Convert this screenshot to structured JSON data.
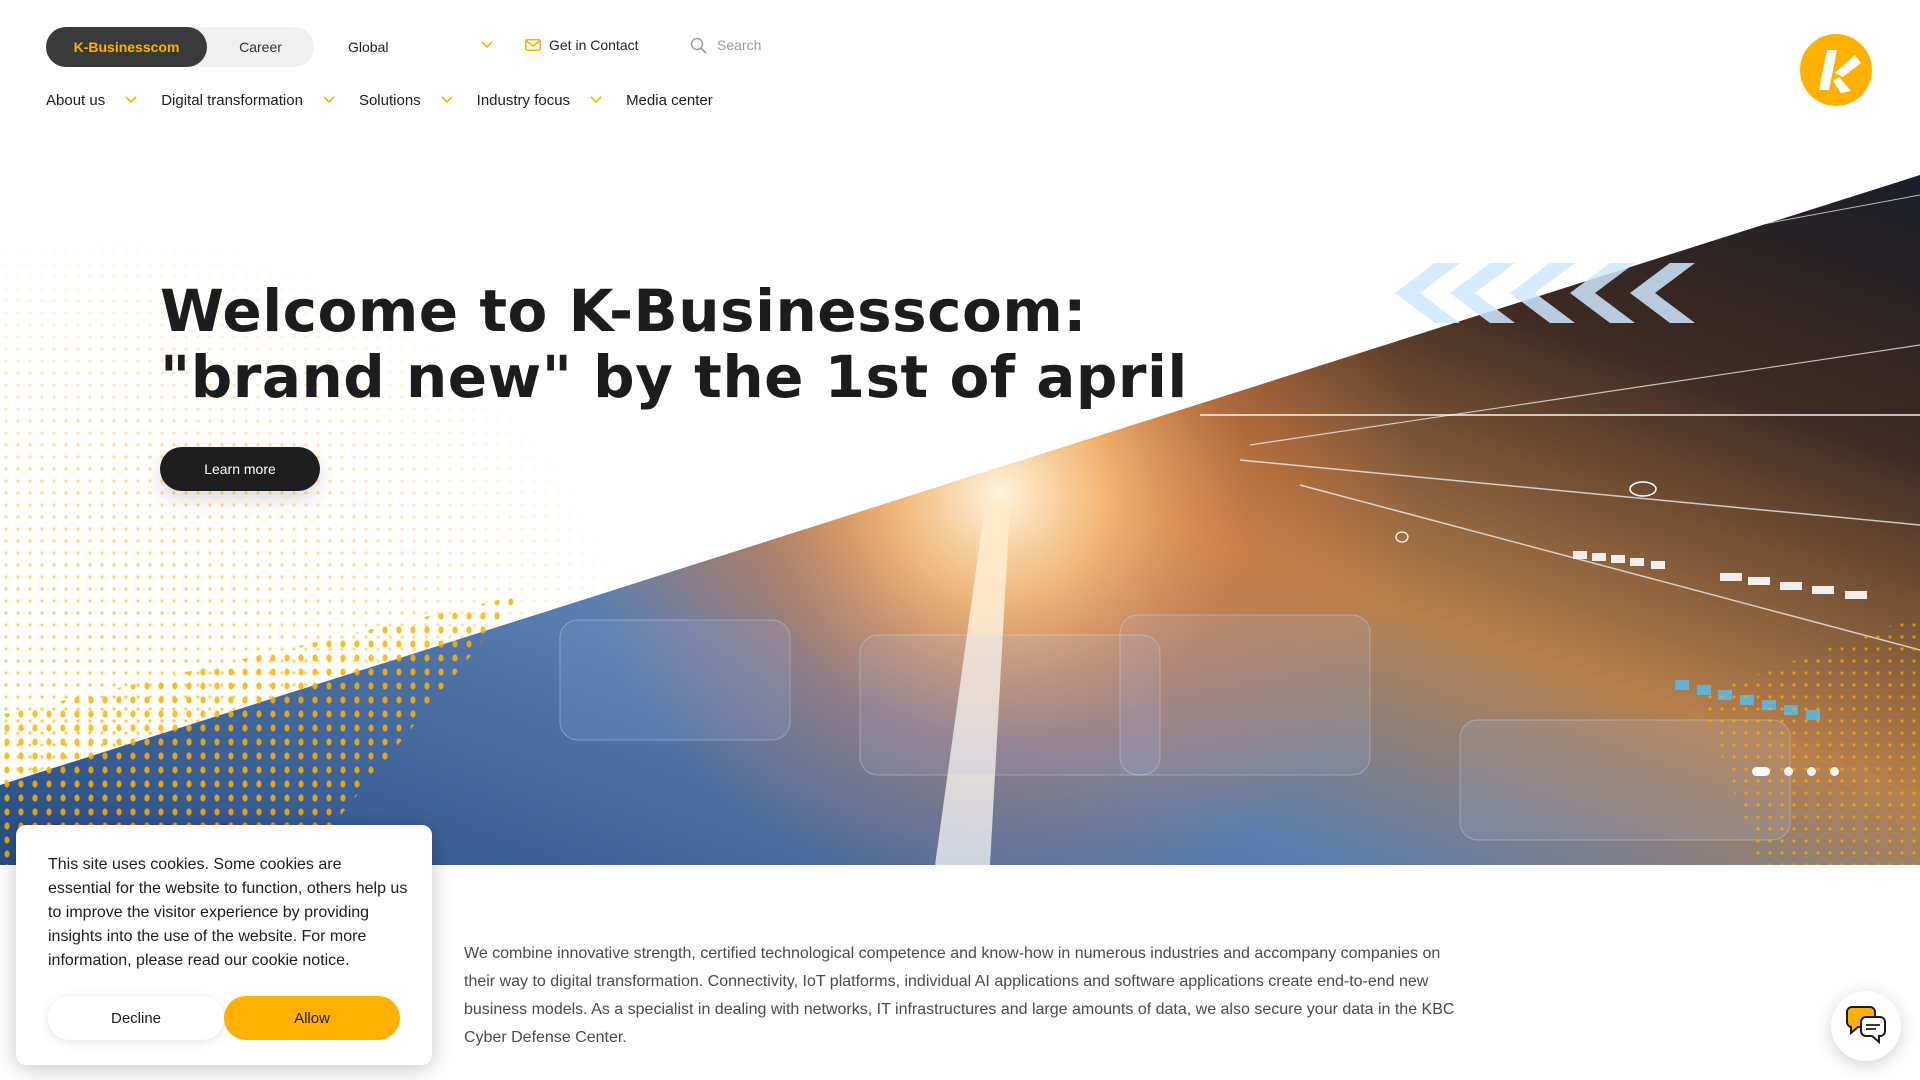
{
  "header": {
    "segments": {
      "active": "K-Businesscom",
      "career": "Career"
    },
    "region": "Global",
    "contact_label": "Get in Contact",
    "search_placeholder": "Search"
  },
  "nav": {
    "items": [
      {
        "label": "About us",
        "has_dropdown": true
      },
      {
        "label": "Digital transformation",
        "has_dropdown": true
      },
      {
        "label": "Solutions",
        "has_dropdown": true
      },
      {
        "label": "Industry focus",
        "has_dropdown": true
      },
      {
        "label": "Media center",
        "has_dropdown": false
      }
    ]
  },
  "hero": {
    "title_line1": "Welcome to K-Businesscom:",
    "title_line2": "\"brand new\" by the 1st of april",
    "cta": "Learn more",
    "slides": 4,
    "active_slide": 1
  },
  "intro": {
    "text": "We combine innovative strength, certified technological competence and know-how in numerous industries and accompany companies on their way to digital transformation. Connectivity, IoT platforms, individual AI applications and software applications create end-to-end new business models. As a specialist in dealing with networks, IT infrastructures and large amounts of data, we also secure your data in the KBC Cyber Defense Center."
  },
  "cookie": {
    "text": "This site uses cookies. Some cookies are essential for the website to function, others help us to improve the visitor experience by providing insights into the use of the website. For more information, please read our cookie notice.",
    "decline": "Decline",
    "allow": "Allow"
  },
  "icons": {
    "logo": "k-logo-icon",
    "chat": "chat-bubbles-icon",
    "search": "search-icon",
    "contact": "envelope-icon",
    "dropdown": "chevron-down-icon"
  },
  "colors": {
    "accent": "#ffb000",
    "dark": "#1e1e1e",
    "segment_bg": "#3a3a3a"
  }
}
